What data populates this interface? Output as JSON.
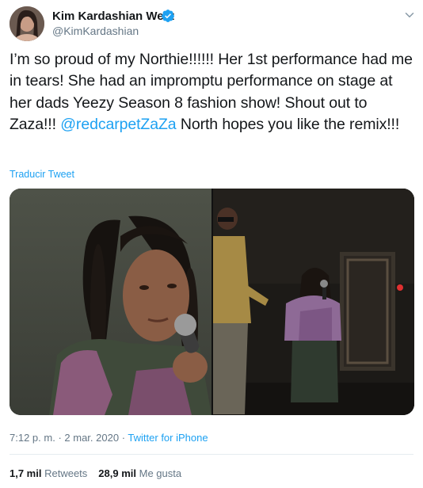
{
  "author": {
    "name": "Kim Kardashian West",
    "handle": "@KimKardashian",
    "avatar_icon": "profile-photo",
    "verified_icon": "verified-badge-icon"
  },
  "tweet": {
    "text_before_mention": "I’m so proud of my Northie!!!!!! Her 1st performance had me in tears! She had an impromptu performance on stage at her dads Yeezy Season 8 fashion show! Shout out to Zaza!!! ",
    "mention": "@redcarpetZaZa",
    "text_after_mention": " North hopes you like the remix!!!"
  },
  "translate_label": "Traducir Tweet",
  "media": {
    "left_photo_icon": "girl-singing-photo",
    "right_photo_icon": "stage-performance-photo"
  },
  "meta": {
    "time": "7:12 p. m.",
    "separator": "·",
    "date": "2 mar. 2020",
    "source": "Twitter for iPhone"
  },
  "stats": {
    "retweets_count": "1,7 mil",
    "retweets_label": "Retweets",
    "likes_count": "28,9 mil",
    "likes_label": "Me gusta"
  },
  "colors": {
    "accent": "#1da1f2",
    "text": "#14171a",
    "secondary": "#657786",
    "divider": "#e6ecf0"
  }
}
